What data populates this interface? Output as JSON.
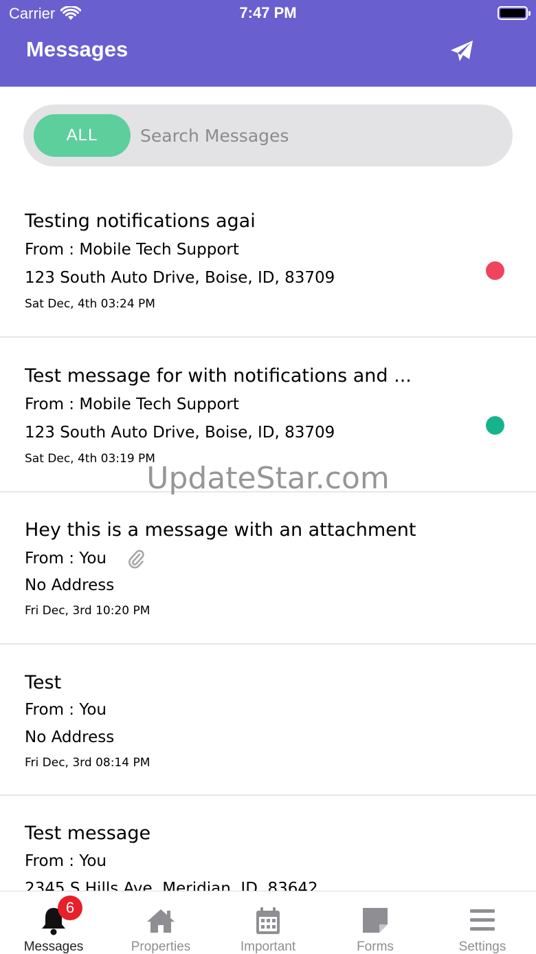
{
  "status_bar": {
    "carrier": "Carrier",
    "time": "7:47 PM"
  },
  "header": {
    "title": "Messages",
    "accent_color": "#6a5fcf",
    "send_icon": "paper-plane-icon"
  },
  "search": {
    "filter_label": "ALL",
    "placeholder": "Search Messages",
    "filter_color": "#5dcf9c"
  },
  "messages": [
    {
      "subject": "Testing notifications agai",
      "from": "From :  Mobile Tech Support",
      "address": "123 South Auto Drive, Boise, ID, 83709",
      "date": "Sat Dec, 4th 03:24 PM",
      "status_color": "#f0435e"
    },
    {
      "subject": "Test message for with notifications and ...",
      "from": "From :  Mobile Tech Support",
      "address": "123 South Auto Drive, Boise, ID, 83709",
      "date": "Sat Dec, 4th 03:19 PM",
      "status_color": "#17b38f"
    },
    {
      "subject": "Hey this is a message with an attachment",
      "from": "From : You",
      "address": "No Address",
      "date": "Fri Dec, 3rd 10:20 PM",
      "attachment_icon": "paperclip-icon"
    },
    {
      "subject": "Test",
      "from": "From : You",
      "address": "No Address",
      "date": "Fri Dec, 3rd 08:14 PM"
    },
    {
      "subject": "Test message",
      "from": "From : You",
      "address": "2345 S Hills Ave, Meridian, ID, 83642"
    }
  ],
  "watermark": "UpdateStar.com",
  "tabbar": {
    "tabs": [
      {
        "label": "Messages",
        "icon": "bell-icon",
        "badge": "6"
      },
      {
        "label": "Properties",
        "icon": "house-icon"
      },
      {
        "label": "Important",
        "icon": "calendar-icon"
      },
      {
        "label": "Forms",
        "icon": "note-icon"
      },
      {
        "label": "Settings",
        "icon": "menu-icon"
      }
    ]
  }
}
